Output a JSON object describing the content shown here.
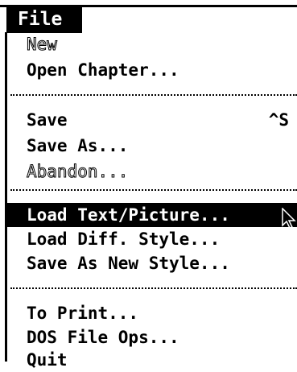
{
  "menu": {
    "title": "File",
    "items": [
      {
        "label": "New",
        "shortcut": "",
        "enabled": false,
        "selected": false
      },
      {
        "label": "Open Chapter...",
        "shortcut": "",
        "enabled": true,
        "selected": false
      },
      {
        "label": "Save",
        "shortcut": "^S",
        "enabled": true,
        "selected": false
      },
      {
        "label": "Save As...",
        "shortcut": "",
        "enabled": true,
        "selected": false
      },
      {
        "label": "Abandon...",
        "shortcut": "",
        "enabled": false,
        "selected": false
      },
      {
        "label": "Load Text/Picture...",
        "shortcut": "",
        "enabled": true,
        "selected": true
      },
      {
        "label": "Load Diff. Style...",
        "shortcut": "",
        "enabled": true,
        "selected": false
      },
      {
        "label": "Save As New Style...",
        "shortcut": "",
        "enabled": true,
        "selected": false
      },
      {
        "label": "To Print...",
        "shortcut": "",
        "enabled": true,
        "selected": false
      },
      {
        "label": "DOS File Ops...",
        "shortcut": "",
        "enabled": true,
        "selected": false
      },
      {
        "label": "Quit",
        "shortcut": "",
        "enabled": true,
        "selected": false
      }
    ]
  },
  "colors": {
    "foreground": "#000000",
    "background": "#ffffff",
    "highlight": "#000000",
    "highlight_text": "#ffffff"
  },
  "icons": {
    "pointer": "mouse-pointer-icon"
  }
}
